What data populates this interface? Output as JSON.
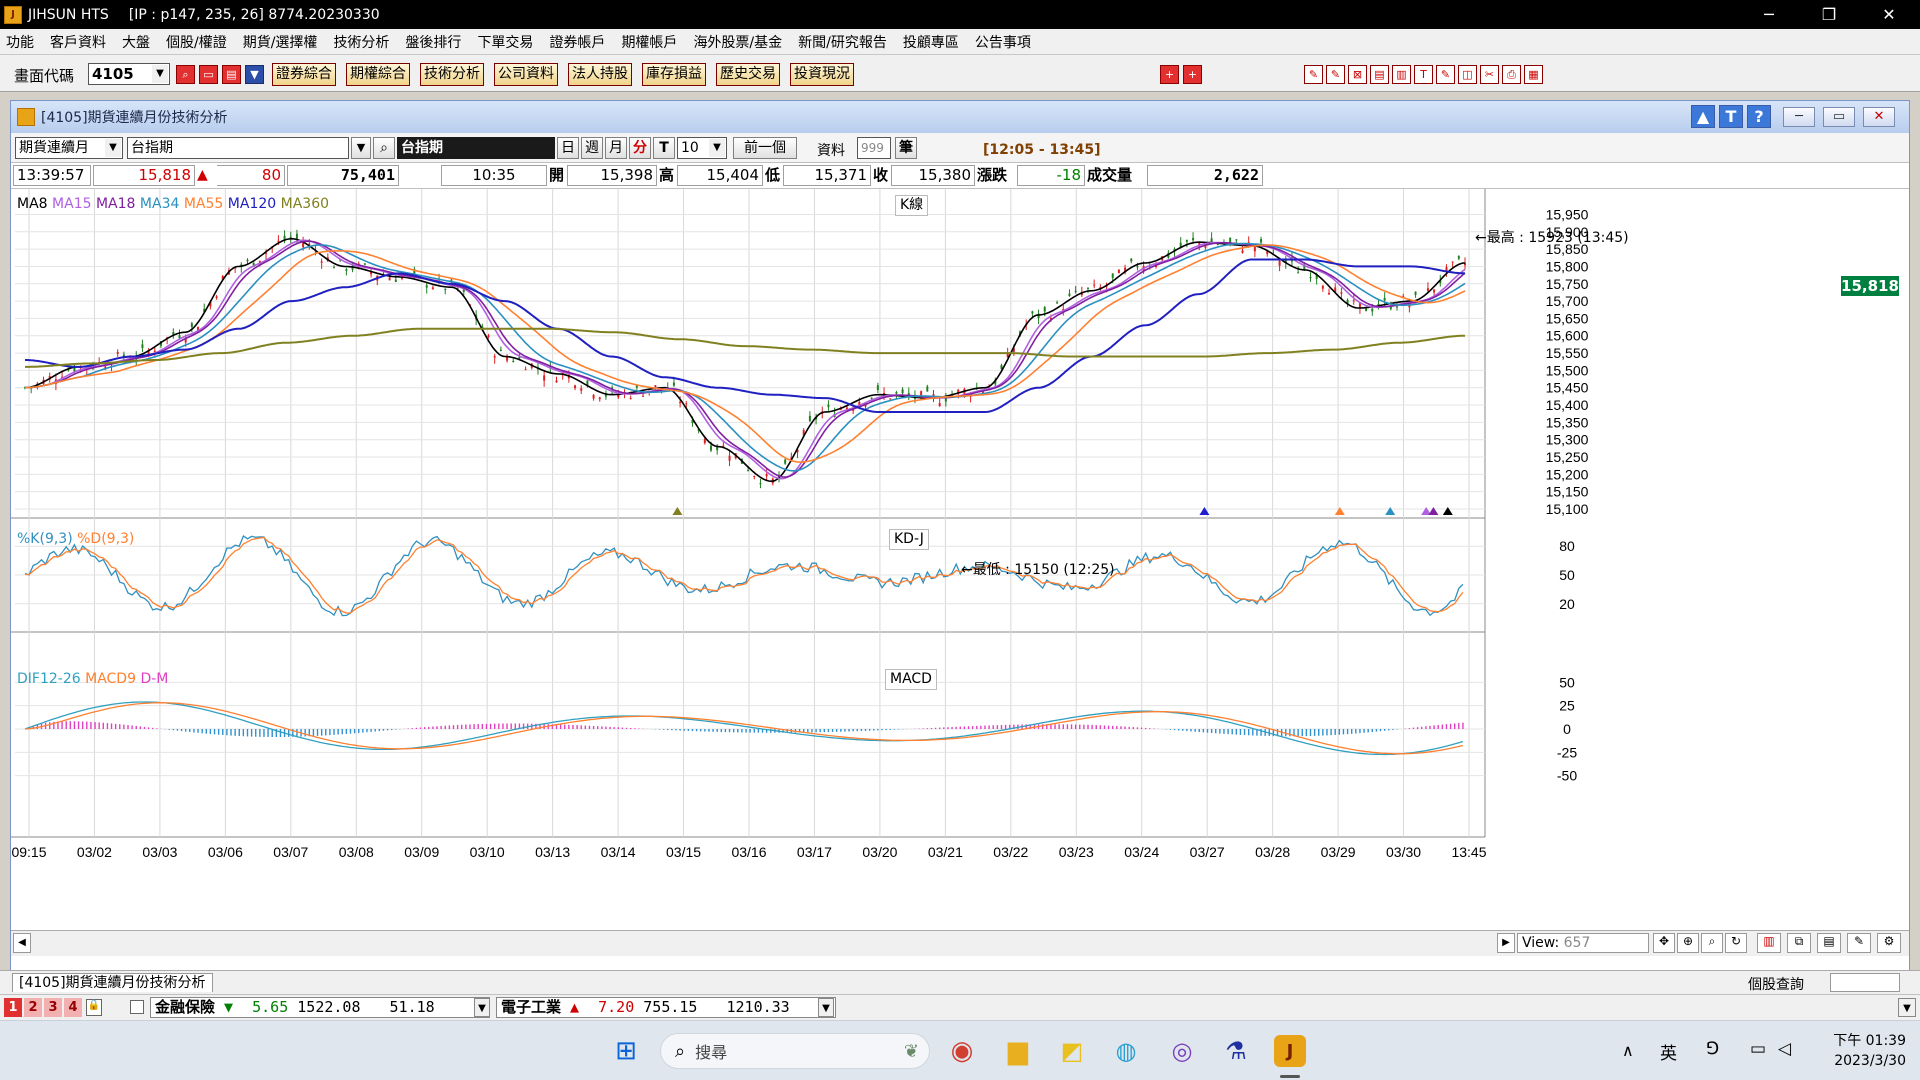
{
  "window": {
    "app_name": "JIHSUN HTS",
    "connection": "[IP : p147, 235, 26] 8774.20230330",
    "minimize": "─",
    "restore": "❐",
    "close": "✕"
  },
  "menu": [
    "功能",
    "客戶資料",
    "大盤",
    "個股/權證",
    "期貨/選擇權",
    "技術分析",
    "盤後排行",
    "下單交易",
    "證券帳戶",
    "期權帳戶",
    "海外股票/基金",
    "新聞/研究報告",
    "投顧專區",
    "公告事項"
  ],
  "toolbar": {
    "code_label": "畫面代碼",
    "code_value": "4105",
    "buttons": [
      "證券綜合",
      "期權綜合",
      "技術分析",
      "公司資料",
      "法人持股",
      "庫存損益",
      "歷史交易",
      "投資現況"
    ]
  },
  "child": {
    "title": "[4105]期貨連續月份技術分析",
    "product_select": "期貨連續月",
    "symbol_input": "台指期",
    "symbol_name": "台指期",
    "period_buttons": [
      "日",
      "週",
      "月",
      "分",
      "T"
    ],
    "interval": "10",
    "prev_button": "前一個",
    "data_label": "資料",
    "data_count": "999",
    "data_unit": "筆",
    "time_range": "[12:05 - 13:45]"
  },
  "quote": {
    "time": "13:39:57",
    "price": "15,818",
    "change": "80",
    "volume_total": "75,401",
    "bar_time": "10:35",
    "open_label": "開",
    "open": "15,398",
    "high_label": "高",
    "high": "15,404",
    "low_label": "低",
    "low": "15,371",
    "close_label": "收",
    "close": "15,380",
    "chg_label": "漲跌",
    "chg": "-18",
    "vol_label": "成交量",
    "vol": "2,622"
  },
  "panels": {
    "k_title": "K線",
    "kd_title": "KD-J",
    "macd_title": "MACD",
    "ma_legend": [
      {
        "name": "MA8",
        "color": "#000000"
      },
      {
        "name": "MA15",
        "color": "#b060e0"
      },
      {
        "name": "MA18",
        "color": "#8020a0"
      },
      {
        "name": "MA34",
        "color": "#2a90c0"
      },
      {
        "name": "MA55",
        "color": "#ff8030"
      },
      {
        "name": "MA120",
        "color": "#2020c0"
      },
      {
        "name": "MA360",
        "color": "#808020"
      }
    ],
    "kd_legend": [
      {
        "name": "%K(9,3)",
        "color": "#3090c0"
      },
      {
        "name": "%D(9,3)",
        "color": "#ff8030"
      }
    ],
    "macd_legend": [
      {
        "name": "DIF12-26",
        "color": "#30a0c0"
      },
      {
        "name": "MACD9",
        "color": "#ff8030"
      },
      {
        "name": "D-M",
        "color": "#e040c0"
      }
    ],
    "high_note": "最高 : 15923 (13:45)",
    "low_note": "最低 : 15150 (12:25)",
    "last_price_tag": "15,818"
  },
  "chart_data": {
    "type": "line",
    "title": "K線",
    "y_ticks": [
      "15,950",
      "15,900",
      "15,850",
      "15,800",
      "15,750",
      "15,700",
      "15,650",
      "15,600",
      "15,550",
      "15,500",
      "15,450",
      "15,400",
      "15,350",
      "15,300",
      "15,250",
      "15,200",
      "15,150",
      "15,100"
    ],
    "kd_ticks": [
      "80",
      "50",
      "20"
    ],
    "macd_ticks": [
      "50",
      "25",
      "0",
      "-25",
      "-50"
    ],
    "x_ticks": [
      "09:15",
      "03/02",
      "03/03",
      "03/06",
      "03/07",
      "03/08",
      "03/09",
      "03/10",
      "03/13",
      "03/14",
      "03/15",
      "03/16",
      "03/17",
      "03/20",
      "03/21",
      "03/22",
      "03/23",
      "03/24",
      "03/27",
      "03/28",
      "03/29",
      "03/30",
      "13:45"
    ],
    "ylim": [
      15100,
      15960
    ],
    "series": [
      {
        "name": "MA8",
        "values": [
          15450,
          15510,
          15540,
          15610,
          15800,
          15880,
          15800,
          15770,
          15740,
          15540,
          15490,
          15430,
          15450,
          15280,
          15180,
          15380,
          15430,
          15420,
          15450,
          15660,
          15730,
          15810,
          15870,
          15860,
          15790,
          15680,
          15700,
          15810
        ]
      },
      {
        "name": "MA120",
        "values": [
          15530,
          15510,
          15540,
          15560,
          15620,
          15700,
          15740,
          15780,
          15750,
          15700,
          15620,
          15540,
          15480,
          15450,
          15430,
          15420,
          15380,
          15380,
          15380,
          15450,
          15540,
          15630,
          15720,
          15820,
          15820,
          15800,
          15800,
          15780
        ]
      },
      {
        "name": "MA360",
        "values": [
          15510,
          15520,
          15530,
          15550,
          15580,
          15600,
          15620,
          15620,
          15620,
          15610,
          15590,
          15570,
          15560,
          15550,
          15550,
          15550,
          15540,
          15540,
          15540,
          15550,
          15560,
          15580,
          15600
        ]
      }
    ]
  },
  "status": {
    "tab_label": "[4105]期貨連續月份技術分析",
    "query_label": "個股查詢",
    "view_label": "View:",
    "view_value": "657",
    "tabs_num": [
      "1",
      "2",
      "3",
      "4"
    ],
    "ticker1_name": "金融保險",
    "ticker1_change": "5.65",
    "ticker1_value": "1522.08",
    "ticker1_volume": "51.18",
    "ticker2_name": "電子工業",
    "ticker2_change": "7.20",
    "ticker2_value": "755.15",
    "ticker2_volume": "1210.33"
  },
  "taskbar": {
    "search_placeholder": "搜尋",
    "clock_time": "下午 01:39",
    "clock_date": "2023/3/30",
    "ime": "英"
  }
}
